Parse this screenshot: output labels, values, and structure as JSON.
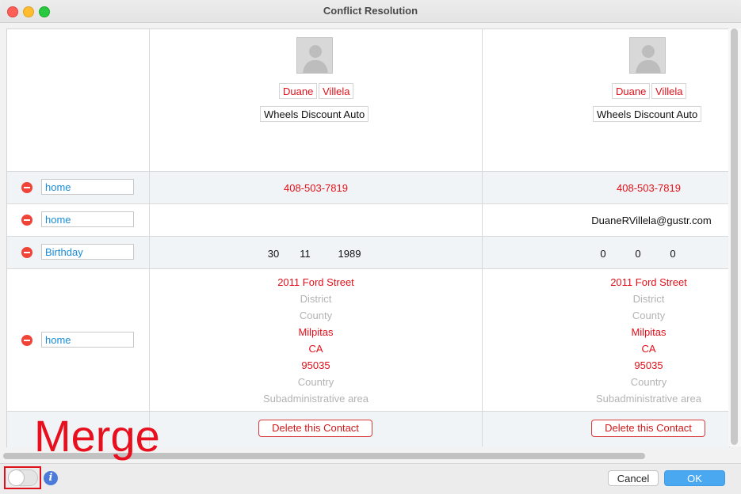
{
  "window": {
    "title": "Conflict Resolution"
  },
  "rows": {
    "phone_label": "home",
    "email_label": "home",
    "birthday_label": "Birthday",
    "address_label": "home"
  },
  "contacts": [
    {
      "first_name": "Duane",
      "last_name": "Villela",
      "company": "Wheels Discount Auto",
      "phone": "408-503-7819",
      "email": "",
      "birthday": {
        "day": "30",
        "month": "11",
        "year": "1989"
      },
      "address": {
        "street": "2011 Ford Street",
        "district": "District",
        "county": "County",
        "city": "Milpitas",
        "state": "CA",
        "zip": "95035",
        "country": "Country",
        "subadmin": "Subadministrative area"
      },
      "delete_label": "Delete this Contact"
    },
    {
      "first_name": "Duane",
      "last_name": "Villela",
      "company": "Wheels Discount Auto",
      "phone": "408-503-7819",
      "email": "DuaneRVillela@gustr.com",
      "birthday": {
        "day": "0",
        "month": "0",
        "year": "0"
      },
      "address": {
        "street": "2011 Ford Street",
        "district": "District",
        "county": "County",
        "city": "Milpitas",
        "state": "CA",
        "zip": "95035",
        "country": "Country",
        "subadmin": "Subadministrative area"
      },
      "delete_label": "Delete this Contact"
    }
  ],
  "annotation": {
    "text": "Merge",
    "color": "#e8101e"
  },
  "footer": {
    "cancel_label": "Cancel",
    "ok_label": "OK",
    "merge_toggle_on": false,
    "info_glyph": "i"
  },
  "colors": {
    "conflict_red": "#e0101a",
    "label_blue": "#1a8bd6",
    "ok_blue": "#4aa8f0"
  }
}
